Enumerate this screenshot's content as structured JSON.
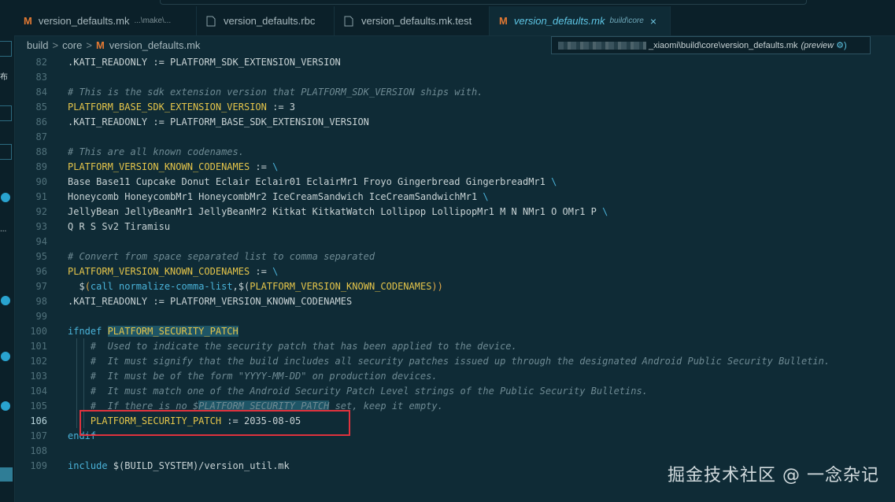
{
  "tabs": [
    {
      "title": "version_defaults.mk",
      "hint": "...\\make\\..."
    },
    {
      "title": "version_defaults.rbc",
      "hint": ""
    },
    {
      "title": "version_defaults.mk.test",
      "hint": ""
    },
    {
      "title": "version_defaults.mk",
      "hint": "build\\core",
      "close": "×"
    }
  ],
  "breadcrumb": [
    "build",
    "core",
    "version_defaults.mk"
  ],
  "breadcrumb_sep": ">",
  "tooltip": {
    "path": "_xiaomi\\build\\core\\version_defaults.mk",
    "preview": "(preview",
    "gear": "⚙)"
  },
  "activity_text": [
    "布",
    "..."
  ],
  "code_lines": [
    {
      "n": "82",
      "segs": [
        {
          "t": ".KATI_READONLY := PLATFORM_SDK_EXTENSION_VERSION",
          "c": ""
        }
      ]
    },
    {
      "n": "83",
      "segs": []
    },
    {
      "n": "84",
      "segs": [
        {
          "t": "# This is the sdk extension version that PLATFORM_SDK_VERSION ships with.",
          "c": "c-com"
        }
      ]
    },
    {
      "n": "85",
      "segs": [
        {
          "t": "PLATFORM_BASE_SDK_EXTENSION_VERSION",
          "c": "c-var"
        },
        {
          "t": " := 3",
          "c": ""
        }
      ]
    },
    {
      "n": "86",
      "segs": [
        {
          "t": ".KATI_READONLY := PLATFORM_BASE_SDK_EXTENSION_VERSION",
          "c": ""
        }
      ]
    },
    {
      "n": "87",
      "segs": []
    },
    {
      "n": "88",
      "segs": [
        {
          "t": "# This are all known codenames.",
          "c": "c-com"
        }
      ]
    },
    {
      "n": "89",
      "segs": [
        {
          "t": "PLATFORM_VERSION_KNOWN_CODENAMES",
          "c": "c-var"
        },
        {
          "t": " := ",
          "c": ""
        },
        {
          "t": "\\",
          "c": "c-kw"
        }
      ]
    },
    {
      "n": "90",
      "segs": [
        {
          "t": "Base Base11 Cupcake Donut Eclair Eclair01 EclairMr1 Froyo Gingerbread GingerbreadMr1 ",
          "c": ""
        },
        {
          "t": "\\",
          "c": "c-kw"
        }
      ]
    },
    {
      "n": "91",
      "segs": [
        {
          "t": "Honeycomb HoneycombMr1 HoneycombMr2 IceCreamSandwich IceCreamSandwichMr1 ",
          "c": ""
        },
        {
          "t": "\\",
          "c": "c-kw"
        }
      ]
    },
    {
      "n": "92",
      "segs": [
        {
          "t": "JellyBean JellyBeanMr1 JellyBeanMr2 Kitkat KitkatWatch Lollipop LollipopMr1 M N NMr1 O OMr1 P ",
          "c": ""
        },
        {
          "t": "\\",
          "c": "c-kw"
        }
      ]
    },
    {
      "n": "93",
      "segs": [
        {
          "t": "Q R S Sv2 Tiramisu",
          "c": ""
        }
      ]
    },
    {
      "n": "94",
      "segs": []
    },
    {
      "n": "95",
      "segs": [
        {
          "t": "# Convert from space separated list to comma separated",
          "c": "c-com"
        }
      ]
    },
    {
      "n": "96",
      "segs": [
        {
          "t": "PLATFORM_VERSION_KNOWN_CODENAMES",
          "c": "c-var"
        },
        {
          "t": " := ",
          "c": ""
        },
        {
          "t": "\\",
          "c": "c-kw"
        }
      ]
    },
    {
      "n": "97",
      "segs": [
        {
          "t": "  $",
          "c": ""
        },
        {
          "t": "(",
          "c": "c-paren"
        },
        {
          "t": "call normalize-comma-list",
          "c": "c-fn"
        },
        {
          "t": ",$(",
          "c": ""
        },
        {
          "t": "PLATFORM_VERSION_KNOWN_CODENAMES",
          "c": "c-var"
        },
        {
          "t": "))",
          "c": "c-paren"
        }
      ]
    },
    {
      "n": "98",
      "segs": [
        {
          "t": ".KATI_READONLY := PLATFORM_VERSION_KNOWN_CODENAMES",
          "c": ""
        }
      ]
    },
    {
      "n": "99",
      "segs": []
    },
    {
      "n": "100",
      "segs": [
        {
          "t": "ifndef ",
          "c": "c-kw"
        },
        {
          "t": "PLATFORM_SECURITY_PATCH",
          "c": "c-var c-hl"
        }
      ]
    },
    {
      "n": "101",
      "segs": [
        {
          "t": "    #  Used to indicate the security patch that has been applied to the device.",
          "c": "c-com"
        }
      ]
    },
    {
      "n": "102",
      "segs": [
        {
          "t": "    #  It must signify that the build includes all security patches issued up through the designated Android Public Security Bulletin.",
          "c": "c-com"
        }
      ]
    },
    {
      "n": "103",
      "segs": [
        {
          "t": "    #  It must be of the form \"YYYY-MM-DD\" on production devices.",
          "c": "c-com"
        }
      ]
    },
    {
      "n": "104",
      "segs": [
        {
          "t": "    #  It must match one of the Android Security Patch Level strings of the Public Security Bulletins.",
          "c": "c-com"
        }
      ]
    },
    {
      "n": "105",
      "segs": [
        {
          "t": "    #  If there is no $",
          "c": "c-com"
        },
        {
          "t": "PLATFORM_SECURITY_PATCH",
          "c": "c-com c-hl"
        },
        {
          "t": " set, keep it empty.",
          "c": "c-com"
        }
      ]
    },
    {
      "n": "106",
      "segs": [
        {
          "t": "    PLATFORM_SECURITY_PATCH",
          "c": "c-var"
        },
        {
          "t": " := 2035-08-05",
          "c": ""
        }
      ]
    },
    {
      "n": "107",
      "segs": [
        {
          "t": "endif",
          "c": "c-kw"
        }
      ]
    },
    {
      "n": "108",
      "segs": []
    },
    {
      "n": "109",
      "segs": [
        {
          "t": "include ",
          "c": "c-kw"
        },
        {
          "t": "$(BUILD_SYSTEM)/version_util.mk",
          "c": ""
        }
      ]
    }
  ],
  "current_line": "106",
  "watermark": "掘金技术社区 @ 一念杂记",
  "colors": {
    "background": "#0f2b36",
    "accent": "#5ec6e5",
    "highlight_box": "#e0323d",
    "makefile_icon": "#e37933"
  }
}
